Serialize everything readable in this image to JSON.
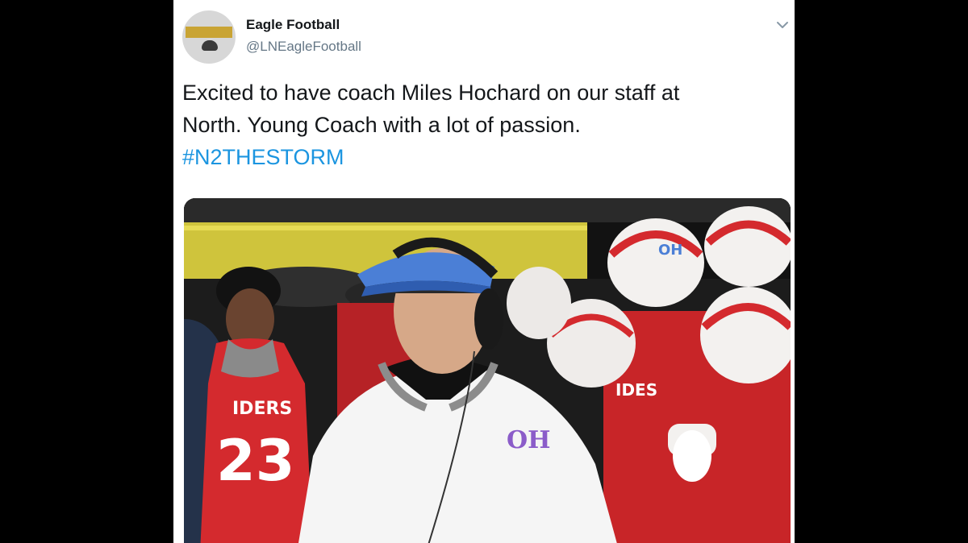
{
  "tweet": {
    "author_name": "Eagle Football",
    "author_handle": "@LNEagleFootball",
    "text_line1": "Excited to have coach Miles Hochard on our staff at",
    "text_line2": "North.  Young Coach with a lot of passion.",
    "hashtag": "#N2THESTORM",
    "menu_icon": "chevron-down-icon"
  },
  "photo": {
    "alt": "Football coach wearing a headset on the sideline with players in red uniforms and white helmets",
    "jersey_text": "IDERS",
    "jersey_number": "23",
    "jersey_text_2": "IDES",
    "helmet_logo": "OH"
  },
  "colors": {
    "text": "#14171a",
    "handle": "#657786",
    "hashtag": "#1b95e0",
    "jersey_red": "#d42a2e",
    "helmet_white": "#f3f1ef",
    "visor_blue": "#4b7fd6"
  }
}
